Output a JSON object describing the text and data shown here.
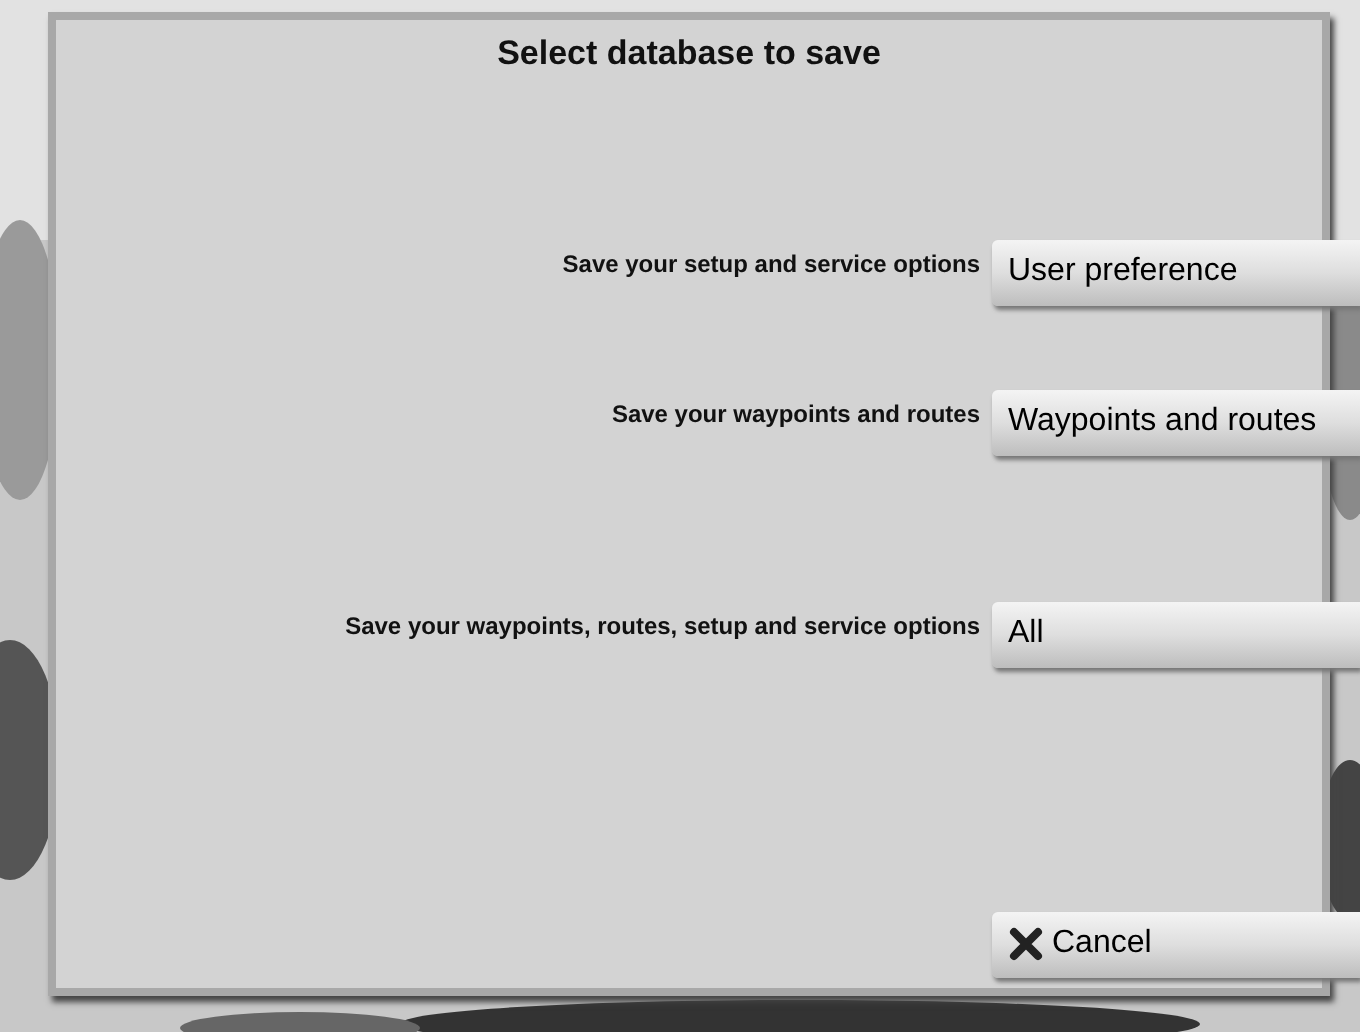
{
  "dialog": {
    "title": "Select database to save"
  },
  "options": [
    {
      "label": "Save your setup and service options",
      "button": "User preference"
    },
    {
      "label": "Save your waypoints and routes",
      "button": "Waypoints and routes"
    },
    {
      "label": "Save your waypoints, routes, setup and service options",
      "button": "All"
    }
  ],
  "cancel": {
    "label": "Cancel"
  }
}
